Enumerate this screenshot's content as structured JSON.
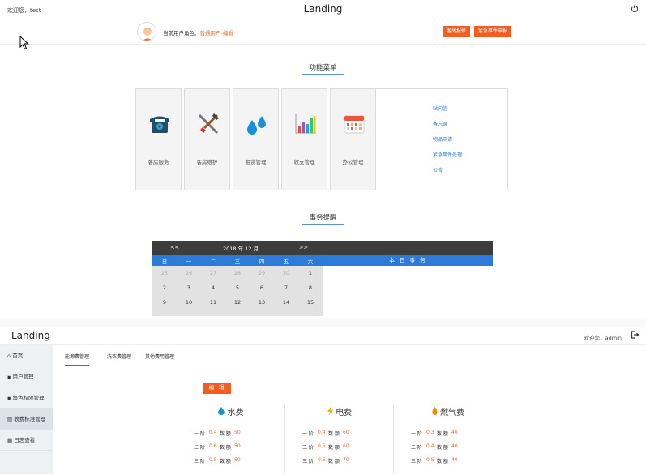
{
  "top": {
    "welcome": "欢迎您，test",
    "title": "Landing",
    "role_label": "当前用户角色：",
    "role_value": "普通用户",
    "role_edit": "-编辑",
    "btn_repair": "客房报修",
    "btn_emergency": "紧急事件申报",
    "section_menu": "功能菜单",
    "tiles": [
      {
        "label": "客房服务",
        "icon": "telephone-icon"
      },
      {
        "label": "客房维护",
        "icon": "tools-icon"
      },
      {
        "label": "租赁管理",
        "icon": "water-drops-icon"
      },
      {
        "label": "收支管理",
        "icon": "bar-chart-icon"
      },
      {
        "label": "办公管理",
        "icon": "calendar-icon"
      }
    ],
    "links": [
      "站内信",
      "备忘录",
      "物品申请",
      "紧急事件处理",
      "公告"
    ],
    "section_affairs": "事务提醒",
    "calendar": {
      "prev": "<<",
      "next": ">>",
      "month": "2018 年 12 月",
      "weekdays": [
        "日",
        "一",
        "二",
        "三",
        "四",
        "五",
        "六"
      ],
      "today_header": "本 日 事 务",
      "rows": [
        [
          "25",
          "26",
          "27",
          "28",
          "29",
          "30",
          "1"
        ],
        [
          "2",
          "3",
          "4",
          "5",
          "6",
          "7",
          "8"
        ],
        [
          "9",
          "10",
          "11",
          "12",
          "13",
          "14",
          "15"
        ]
      ]
    }
  },
  "bottom": {
    "brand": "Landing",
    "welcome": "欢迎您，admin",
    "sidebar": [
      "首页",
      "用户管理",
      "角色权限管理",
      "收费标准管理",
      "日志查看"
    ],
    "tabs": [
      "能源费管理",
      "洗衣费管理",
      "其他费用管理"
    ],
    "edit": "编 辑",
    "fees": [
      {
        "name": "水费",
        "icon": "water-drop-icon",
        "rows": [
          [
            "一 阶",
            "0.4",
            "数 额",
            "50"
          ],
          [
            "二 阶",
            "0.6",
            "数 额",
            "50"
          ],
          [
            "三 阶",
            "0.5",
            "数 额",
            "50"
          ]
        ]
      },
      {
        "name": "电费",
        "icon": "lightning-icon",
        "rows": [
          [
            "一 阶",
            "0.4",
            "数 额",
            "60"
          ],
          [
            "二 阶",
            "0.5",
            "数 额",
            "60"
          ],
          [
            "三 阶",
            "0.6",
            "数 额",
            "70"
          ]
        ]
      },
      {
        "name": "燃气费",
        "icon": "flame-icon",
        "rows": [
          [
            "一 阶",
            "0.3",
            "数 额",
            "40"
          ],
          [
            "二 阶",
            "0.4",
            "数 额",
            "40"
          ],
          [
            "三 阶",
            "0.5",
            "数 额",
            "40"
          ]
        ]
      }
    ]
  }
}
